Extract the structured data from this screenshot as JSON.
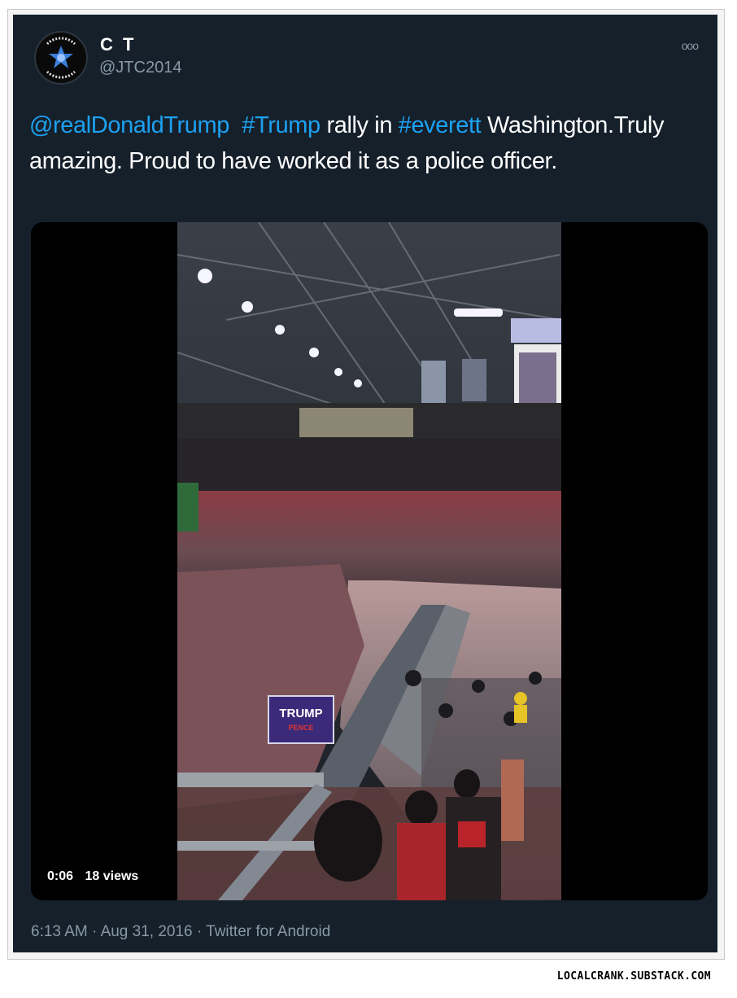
{
  "author": {
    "display_name": "C T",
    "handle": "@JTC2014",
    "avatar_icon": "police-badge-avatar-icon"
  },
  "more_icon": "ooo",
  "tweet": {
    "mention": "@realDonaldTrump",
    "hashtag1": "#Trump",
    "text1": " rally in ",
    "hashtag2": "#everett",
    "text2": " Washington.Truly amazing. Proud to have worked it as a police officer."
  },
  "media": {
    "duration": "0:06",
    "views": "18 views",
    "sign_line1": "TRUMP",
    "sign_line2": "PENCE"
  },
  "meta": {
    "time": "6:13 AM",
    "date": "Aug 31, 2016",
    "source": "Twitter for Android",
    "separator": "·"
  },
  "watermark": "LOCALCRANK.SUBSTACK.COM",
  "colors": {
    "background": "#15202b",
    "link": "#1da1f2",
    "secondary_text": "#8899a6"
  }
}
